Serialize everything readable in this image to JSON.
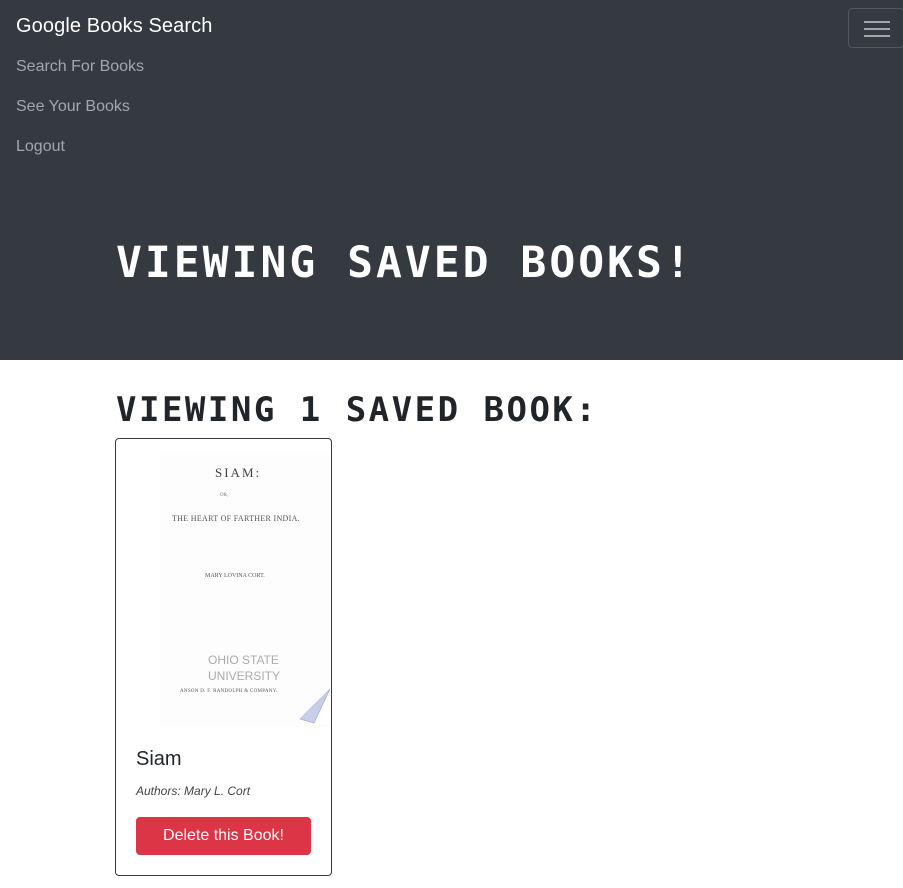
{
  "navbar": {
    "brand": "Google Books Search",
    "links": [
      "Search For Books",
      "See Your Books",
      "Logout"
    ]
  },
  "hero": {
    "title": "Viewing saved books!"
  },
  "main": {
    "section_title": "Viewing 1 saved book:",
    "books": [
      {
        "title": "Siam",
        "authors": "Authors: Mary L. Cort",
        "delete_label": "Delete this Book!"
      }
    ]
  },
  "colors": {
    "navbar_bg": "#343a40",
    "danger": "#dc3545"
  }
}
